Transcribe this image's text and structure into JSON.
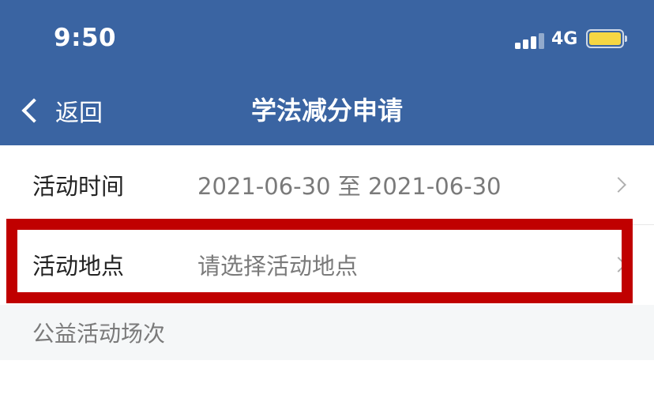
{
  "status_bar": {
    "time": "9:50",
    "network": "4G",
    "signal_icon": "signal-bars-icon",
    "battery_icon": "battery-icon",
    "battery_color": "#f6d743"
  },
  "nav": {
    "back_label": "返回",
    "back_icon": "chevron-left-icon",
    "title": "学法减分申请",
    "background_color": "#3a64a2"
  },
  "form": {
    "rows": [
      {
        "label": "活动时间",
        "value": "2021-06-30 至 2021-06-30",
        "icon": "chevron-right-icon"
      },
      {
        "label": "活动地点",
        "placeholder": "请选择活动地点",
        "icon": "chevron-right-icon"
      }
    ]
  },
  "section": {
    "title": "公益活动场次"
  },
  "highlight_color": "#c00000"
}
